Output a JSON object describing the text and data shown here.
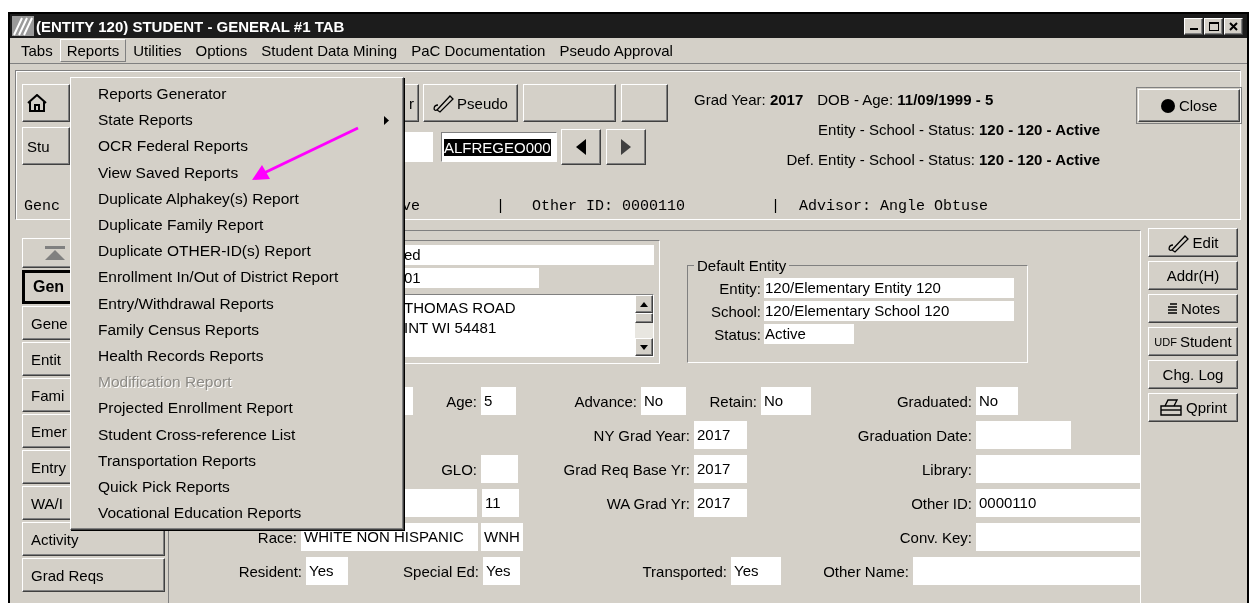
{
  "window": {
    "title": "(ENTITY 120) STUDENT - GENERAL #1 TAB"
  },
  "menu_bar": [
    {
      "label": "Tabs",
      "selected": false
    },
    {
      "label": "Reports",
      "selected": true
    },
    {
      "label": "Utilities",
      "selected": false
    },
    {
      "label": "Options",
      "selected": false
    },
    {
      "label": "Student Data Mining",
      "selected": false
    },
    {
      "label": "PaC Documentation",
      "selected": false
    },
    {
      "label": "Pseudo Approval",
      "selected": false
    }
  ],
  "reports_menu": [
    {
      "label": "Reports Generator",
      "disabled": false,
      "submenu": false
    },
    {
      "label": "State Reports",
      "disabled": false,
      "submenu": true
    },
    {
      "label": "OCR Federal Reports",
      "disabled": false,
      "submenu": false
    },
    {
      "label": "View Saved Reports",
      "disabled": false,
      "submenu": false
    },
    {
      "label": "Duplicate Alphakey(s) Report",
      "disabled": false,
      "submenu": false
    },
    {
      "label": "Duplicate Family Report",
      "disabled": false,
      "submenu": false
    },
    {
      "label": "Duplicate OTHER-ID(s) Report",
      "disabled": false,
      "submenu": false
    },
    {
      "label": "Enrollment In/Out of District Report",
      "disabled": false,
      "submenu": false
    },
    {
      "label": "Entry/Withdrawal Reports",
      "disabled": false,
      "submenu": false
    },
    {
      "label": "Family Census Reports",
      "disabled": false,
      "submenu": false
    },
    {
      "label": "Health Records Reports",
      "disabled": false,
      "submenu": false
    },
    {
      "label": "Modification Report",
      "disabled": true,
      "submenu": false
    },
    {
      "label": "Projected Enrollment Report",
      "disabled": false,
      "submenu": false
    },
    {
      "label": "Student Cross-reference List",
      "disabled": false,
      "submenu": false
    },
    {
      "label": "Transportation Reports",
      "disabled": false,
      "submenu": false
    },
    {
      "label": "Quick Pick Reports",
      "disabled": false,
      "submenu": false
    },
    {
      "label": "Vocational Education Reports",
      "disabled": false,
      "submenu": false
    }
  ],
  "toolbar_left": [
    {
      "kind": "home"
    },
    {
      "kind": "text",
      "label": "Stu"
    }
  ],
  "toolbar": {
    "row_1": [
      {
        "kind": "text",
        "label": "r"
      },
      {
        "kind": "pen",
        "label": "Pseudo"
      },
      {
        "kind": "blank"
      },
      {
        "kind": "blank"
      }
    ],
    "row_2": [
      {
        "kind": "field"
      },
      {
        "kind": "field",
        "value": "ALFREGEO000",
        "selected": true
      },
      {
        "kind": "prev"
      },
      {
        "kind": "next"
      }
    ]
  },
  "summary_lines": [
    [
      {
        "label": "Grad Year:",
        "value": "2017"
      },
      {
        "label": "DOB - Age:",
        "value": "11/09/1999 - 5"
      }
    ],
    [
      {
        "label": "Entity - School - Status:",
        "value": "120 - 120 - Active"
      }
    ],
    [
      {
        "label": "Def. Entity - School - Status:",
        "value": "120 - 120 - Active"
      }
    ]
  ],
  "close_button": {
    "label": "Close"
  },
  "status_line": [
    "Genc",
    "ve",
    "|",
    "Other ID: 0000110",
    "|",
    "Advisor: Angle Obtuse"
  ],
  "sidebar": {
    "tabs": [
      {
        "label": "Gen",
        "selected": true
      },
      {
        "label": "Gene",
        "selected": false
      },
      {
        "label": "Entit",
        "selected": false
      },
      {
        "label": "Fami",
        "selected": false
      },
      {
        "label": "Emer",
        "selected": false
      },
      {
        "label": "Entry",
        "selected": false
      },
      {
        "label": "WA/I",
        "selected": false
      },
      {
        "label": "Activity",
        "selected": false
      },
      {
        "label": "Grad Reqs",
        "selected": false
      }
    ]
  },
  "name_panel": {
    "fields": [
      "ed",
      "01"
    ],
    "address": [
      "THOMAS ROAD",
      "INT WI 54481"
    ]
  },
  "default_entity": {
    "title": "Default Entity",
    "fields": [
      {
        "label": "Entity:",
        "value": "120/Elementary Entity 120"
      },
      {
        "label": "School:",
        "value": "120/Elementary School 120"
      },
      {
        "label": "Status:",
        "value": "Active"
      }
    ]
  },
  "form_rows": [
    [
      {
        "kind": "box"
      },
      {
        "kind": "field",
        "label": "Age:",
        "value": "5"
      },
      {
        "kind": "field",
        "label": "Advance:",
        "value": "No"
      },
      {
        "kind": "field",
        "label": "Retain:",
        "value": "No"
      },
      {
        "kind": "field",
        "label": "Graduated:",
        "value": "No"
      }
    ],
    [
      {
        "kind": "field",
        "label": "NY Grad Year:",
        "value": "2017"
      },
      {
        "kind": "field",
        "label": "Graduation Date:"
      }
    ],
    [
      {
        "kind": "field",
        "label": "GLO:"
      },
      {
        "kind": "field",
        "label": "Grad Req Base Yr:",
        "value": "2017"
      },
      {
        "kind": "field",
        "label": "Library:"
      }
    ],
    [
      {
        "kind": "box"
      },
      {
        "kind": "box",
        "value": "11"
      },
      {
        "kind": "field",
        "label": "WA Grad Yr:",
        "value": "2017"
      },
      {
        "kind": "field",
        "label": "Other ID:",
        "value": "0000110"
      }
    ],
    [
      {
        "kind": "field",
        "label": "Race:",
        "value": "WHITE NON HISPANIC"
      },
      {
        "kind": "box",
        "value": "WNH"
      },
      {
        "kind": "field",
        "label": "Conv. Key:"
      }
    ],
    [
      {
        "kind": "field",
        "label": "Resident:",
        "value": "Yes"
      },
      {
        "kind": "field",
        "label": "Special Ed:",
        "value": "Yes"
      },
      {
        "kind": "field",
        "label": "Transported:",
        "value": "Yes"
      },
      {
        "kind": "field",
        "label": "Other Name:"
      }
    ]
  ],
  "side_buttons": [
    {
      "kind": "edit",
      "label": "Edit"
    },
    {
      "kind": "plain",
      "label": "Addr(H)"
    },
    {
      "kind": "notes",
      "label": "Notes"
    },
    {
      "kind": "udf",
      "prefix": "UDF",
      "label": "Student"
    },
    {
      "kind": "plain",
      "label": "Chg. Log"
    },
    {
      "kind": "print",
      "label": "Qprint"
    }
  ]
}
